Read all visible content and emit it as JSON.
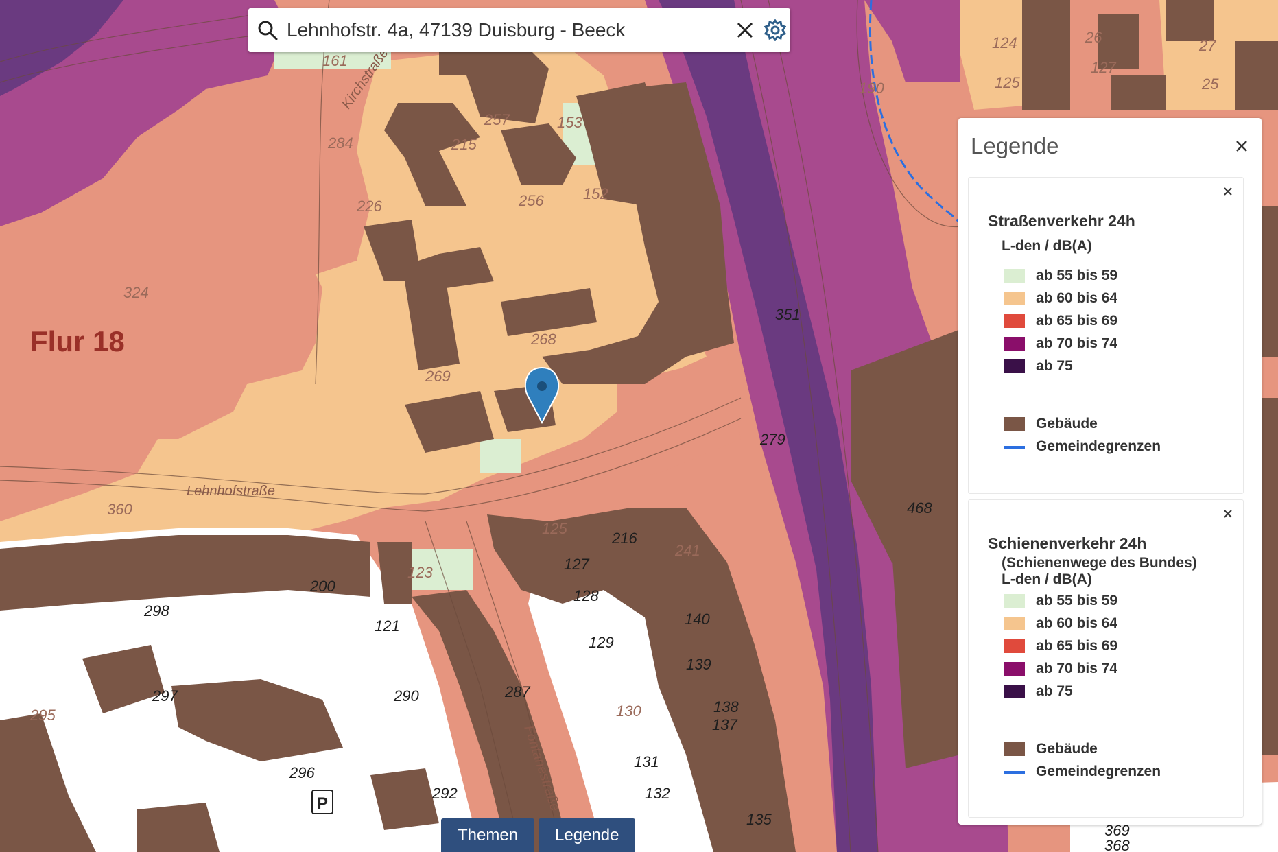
{
  "search": {
    "value": "Lehnhofstr. 4a, 47139 Duisburg - Beeck",
    "placeholder": ""
  },
  "icons": {
    "search": "search-icon",
    "clear": "close-icon",
    "settings": "gear-icon",
    "marker": "location-marker-icon",
    "parking": "parking-sign-icon"
  },
  "map": {
    "flur_label": "Flur 18",
    "street_labels": [
      "Lehnhofstraße",
      "Fontanestraße",
      "Kirchstraße"
    ],
    "parcel_numbers": [
      "161",
      "284",
      "215",
      "257",
      "153",
      "152",
      "226",
      "256",
      "324",
      "268",
      "269",
      "190",
      "124",
      "125",
      "127",
      "26",
      "25",
      "27",
      "351",
      "279",
      "360",
      "125",
      "216",
      "241",
      "127",
      "128",
      "129",
      "200",
      "123",
      "121",
      "298",
      "297",
      "290",
      "287",
      "296",
      "292",
      "140",
      "139",
      "130",
      "131",
      "132",
      "135",
      "138",
      "137",
      "468",
      "369",
      "368",
      "295"
    ],
    "parking_symbol": "P"
  },
  "legend": {
    "title": "Legende",
    "sections": [
      {
        "title": "Straßenverkehr 24h",
        "subtitle_lines": [
          "L-den / dB(A)"
        ],
        "entries": [
          {
            "label": "ab 55 bis 59",
            "color": "#dbeed2"
          },
          {
            "label": "ab 60 bis 64",
            "color": "#f5c58e"
          },
          {
            "label": "ab 65 bis 69",
            "color": "#e04a3c"
          },
          {
            "label": "ab 70 bis 74",
            "color": "#8a0e6a"
          },
          {
            "label": "ab 75",
            "color": "#3a1048"
          }
        ],
        "extras": [
          {
            "label": "Gebäude",
            "color": "#7a5646",
            "kind": "fill"
          },
          {
            "label": "Gemeindegrenzen",
            "color": "#2c6fe0",
            "kind": "line"
          }
        ]
      },
      {
        "title": "Schienenverkehr 24h",
        "subtitle_lines": [
          "(Schienenwege des Bundes)",
          "L-den / dB(A)"
        ],
        "entries": [
          {
            "label": "ab 55 bis 59",
            "color": "#dbeed2"
          },
          {
            "label": "ab 60 bis 64",
            "color": "#f5c58e"
          },
          {
            "label": "ab 65 bis 69",
            "color": "#e04a3c"
          },
          {
            "label": "ab 70 bis 74",
            "color": "#8a0e6a"
          },
          {
            "label": "ab 75",
            "color": "#3a1048"
          }
        ],
        "extras": [
          {
            "label": "Gebäude",
            "color": "#7a5646",
            "kind": "fill"
          },
          {
            "label": "Gemeindegrenzen",
            "color": "#2c6fe0",
            "kind": "line"
          }
        ]
      }
    ]
  },
  "bottom_buttons": {
    "themen": "Themen",
    "legende": "Legende"
  },
  "colors": {
    "zone_55_59": "#dbeed2",
    "zone_60_64": "#f5c58e",
    "zone_65_69": "#e6957f",
    "zone_70_74": "#a84a8e",
    "zone_75": "#6a3a80",
    "building": "#7a5646",
    "parcel_white": "#ffffff",
    "button_blue": "#2f4f7e",
    "marker_blue": "#2f7fbd"
  }
}
